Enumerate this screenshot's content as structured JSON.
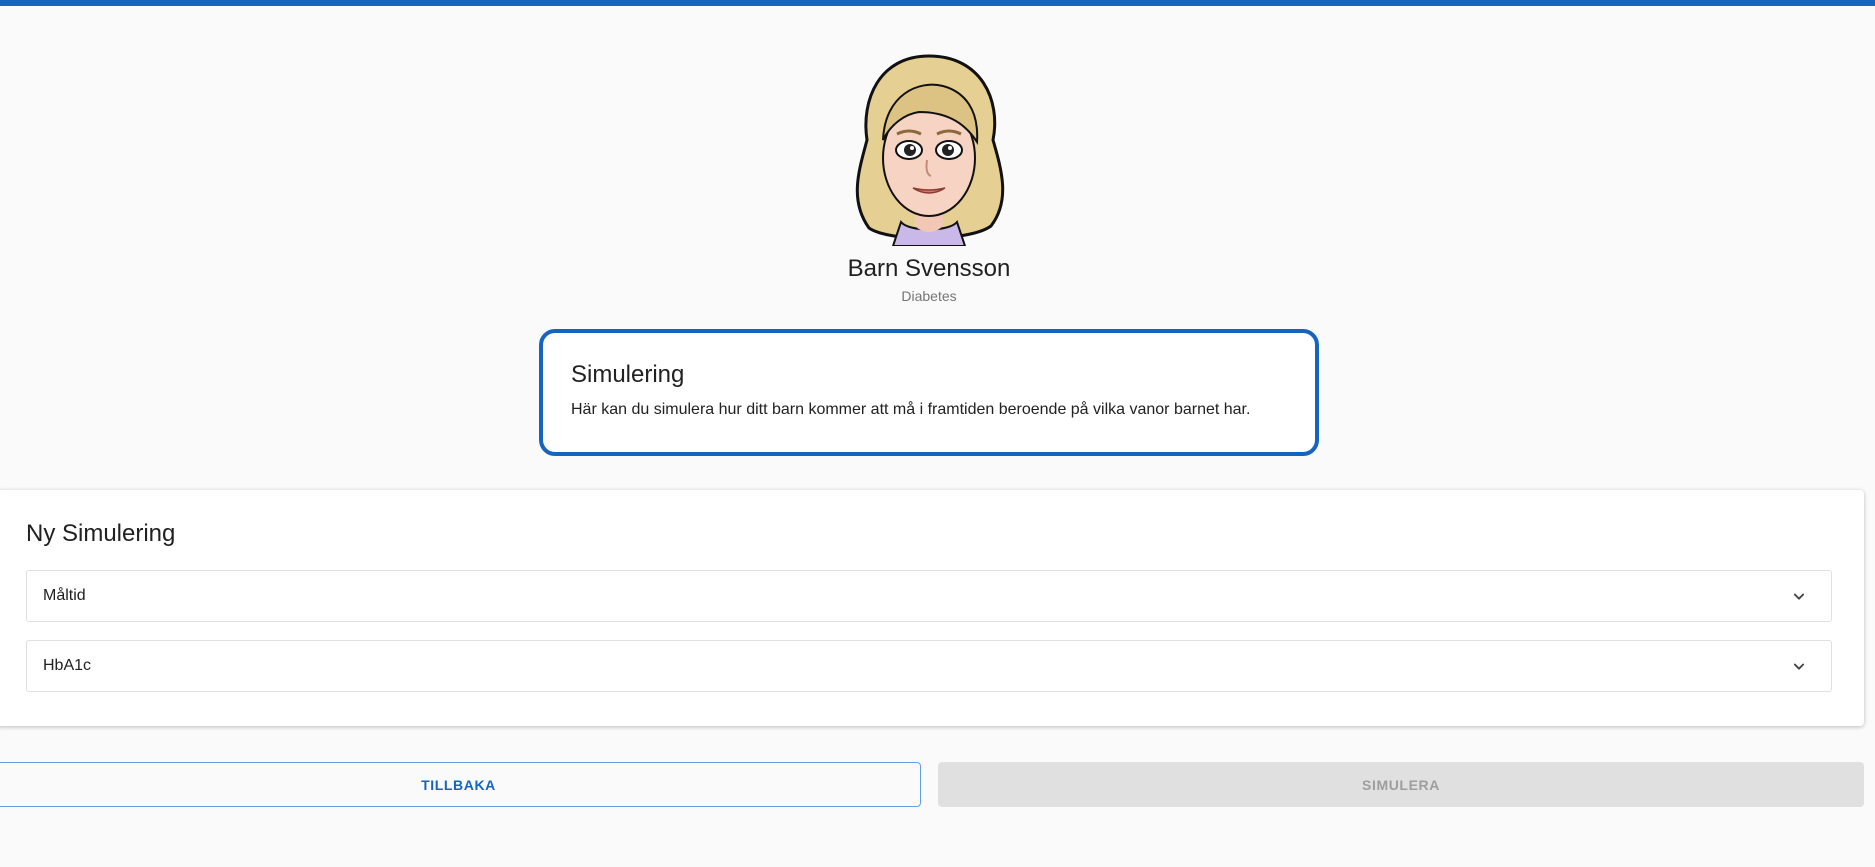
{
  "colors": {
    "accent": "#1565c0",
    "background": "#fafafa",
    "disabled_bg": "#e0e0e0",
    "disabled_text": "#9e9e9e"
  },
  "profile": {
    "avatar_icon": "woman-avatar",
    "name": "Barn Svensson",
    "condition": "Diabetes"
  },
  "info_card": {
    "title": "Simulering",
    "text": "Här kan du simulera hur ditt barn kommer att må i framtiden beroende på vilka vanor barnet har."
  },
  "new_simulation": {
    "title": "Ny Simulering",
    "sections": [
      {
        "label": "Måltid",
        "icon": "chevron-down-icon"
      },
      {
        "label": "HbA1c",
        "icon": "chevron-down-icon"
      }
    ]
  },
  "actions": {
    "back_label": "TILLBAKA",
    "simulate_label": "SIMULERA"
  }
}
